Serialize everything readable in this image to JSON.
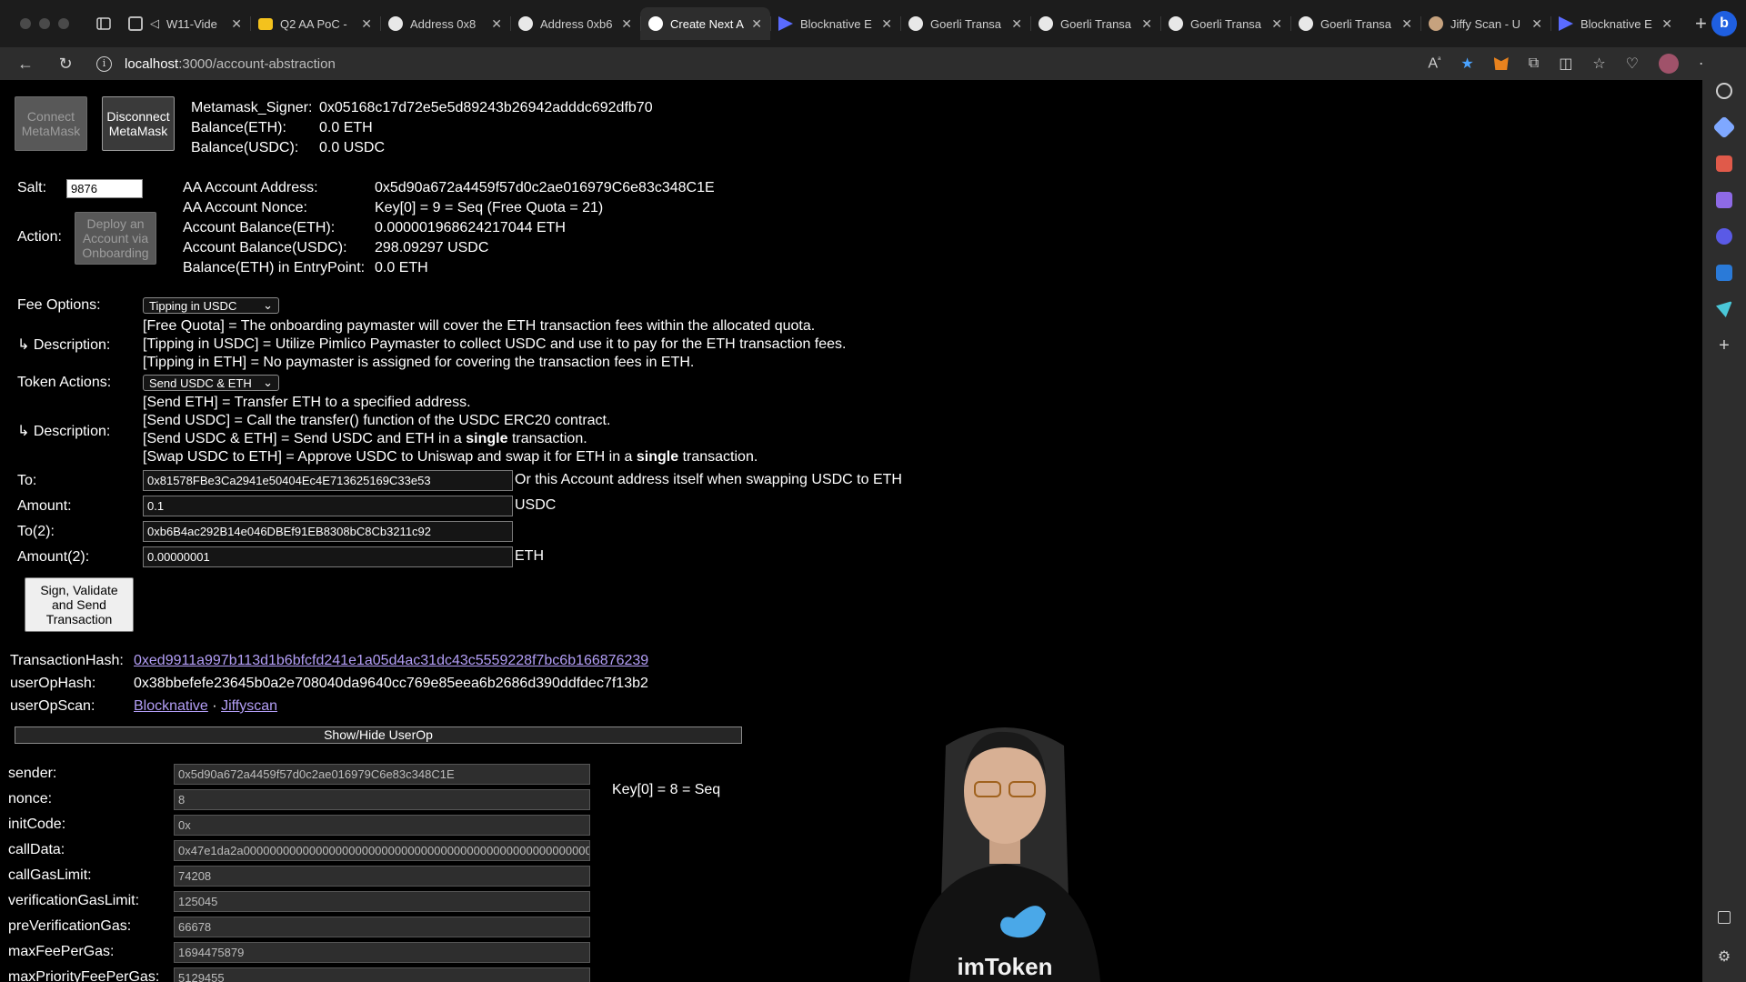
{
  "browser": {
    "tabs": [
      {
        "title": "W11-Vide",
        "icon": "video-tab-icon"
      },
      {
        "title": "Q2 AA PoC - ",
        "icon": "slides-tab-icon"
      },
      {
        "title": "Address 0x8",
        "icon": "etherscan-tab-icon"
      },
      {
        "title": "Address 0xb6",
        "icon": "etherscan-tab-icon"
      },
      {
        "title": "Create Next A",
        "icon": "nextjs-tab-icon",
        "active": true
      },
      {
        "title": "Blocknative E",
        "icon": "blocknative-tab-icon"
      },
      {
        "title": "Goerli Transa",
        "icon": "etherscan-tab-icon"
      },
      {
        "title": "Goerli Transa",
        "icon": "etherscan-tab-icon"
      },
      {
        "title": "Goerli Transa",
        "icon": "etherscan-tab-icon"
      },
      {
        "title": "Goerli Transa",
        "icon": "etherscan-tab-icon"
      },
      {
        "title": "Jiffy Scan - U",
        "icon": "jiffyscan-tab-icon"
      },
      {
        "title": "Blocknative E",
        "icon": "blocknative-tab-icon"
      }
    ],
    "url_host": "localhost",
    "url_path": ":3000/account-abstraction"
  },
  "header": {
    "connect_label": "Connect MetaMask",
    "disconnect_label": "Disconnect MetaMask",
    "signer_label": "Metamask_Signer:",
    "signer_value": "0x05168c17d72e5e5d89243b26942adddc692dfb70",
    "balance_eth_label": "Balance(ETH):",
    "balance_eth_value": "0.0 ETH",
    "balance_usdc_label": "Balance(USDC):",
    "balance_usdc_value": "0.0 USDC"
  },
  "account": {
    "salt_label": "Salt:",
    "salt_value": "9876",
    "action_label": "Action:",
    "deploy_label": "Deploy an Account via Onboarding",
    "address_label": "AA Account Address:",
    "address_value": "0x5d90a672a4459f57d0c2ae016979C6e83c348C1E",
    "nonce_label": "AA Account Nonce:",
    "nonce_value": "Key[0] = 9 = Seq (Free Quota = 21)",
    "acct_eth_label": "Account Balance(ETH):",
    "acct_eth_value": "0.000001968624217044 ETH",
    "acct_usdc_label": "Account Balance(USDC):",
    "acct_usdc_value": "298.09297 USDC",
    "entry_label": "Balance(ETH) in EntryPoint:",
    "entry_value": "0.0 ETH"
  },
  "fees": {
    "label": "Fee Options:",
    "selected": "Tipping in USDC",
    "desc_label": "↳ Description:",
    "lines": [
      "[Free Quota] = The onboarding paymaster will cover the ETH transaction fees within the allocated quota.",
      "[Tipping in USDC] = Utilize Pimlico Paymaster to collect USDC and use it to pay for the ETH transaction fees.",
      "[Tipping in ETH] = No paymaster is assigned for covering the transaction fees in ETH."
    ]
  },
  "tokens": {
    "label": "Token Actions:",
    "selected": "Send USDC & ETH",
    "desc_label": "↳ Description:",
    "line1": "[Send ETH] = Transfer ETH to a specified address.",
    "line2": "[Send USDC] = Call the transfer() function of the USDC ERC20 contract.",
    "line3_a": "[Send USDC & ETH] = Send USDC and ETH in a ",
    "line3_bold": "single",
    "line3_b": " transaction.",
    "line4_a": "[Swap USDC to ETH] = Approve USDC to Uniswap and swap it for ETH in a ",
    "line4_bold": "single",
    "line4_b": " transaction."
  },
  "transfer": {
    "to_label": "To:",
    "to_value": "0x81578FBe3Ca2941e50404Ec4E713625169C33e53",
    "to_note": "Or this Account address itself when swapping USDC to ETH",
    "amount_label": "Amount:",
    "amount_value": "0.1",
    "amount_unit": "USDC",
    "to2_label": "To(2):",
    "to2_value": "0xb6B4ac292B14e046DBEf91EB8308bC8Cb3211c92",
    "amount2_label": "Amount(2):",
    "amount2_value": "0.00000001",
    "amount2_unit": "ETH",
    "send_label": "Sign, Validate and Send Transaction"
  },
  "result": {
    "tx_label": "TransactionHash:",
    "tx_value": "0xed9911a997b113d1b6bfcfd241e1a05d4ac31dc43c5559228f7bc6b166876239",
    "op_label": "userOpHash:",
    "op_value": "0x38bbefefe23645b0a2e708040da9640cc769e85eea6b2686d390ddfdec7f13b2",
    "scan_label": "userOpScan:",
    "scan_link1": "Blocknative",
    "scan_sep": "·",
    "scan_link2": "Jiffyscan",
    "toggle_label": "Show/Hide UserOp"
  },
  "userop": {
    "nonce_note": "Key[0] = 8 = Seq",
    "rows": [
      {
        "label": "sender:",
        "value": "0x5d90a672a4459f57d0c2ae016979C6e83c348C1E"
      },
      {
        "label": "nonce:",
        "value": "8"
      },
      {
        "label": "initCode:",
        "value": "0x"
      },
      {
        "label": "callData:",
        "value": "0x47e1da2a000000000000000000000000000000000000000000000000000000000000"
      },
      {
        "label": "callGasLimit:",
        "value": "74208"
      },
      {
        "label": "verificationGasLimit:",
        "value": "125045"
      },
      {
        "label": "preVerificationGas:",
        "value": "66678"
      },
      {
        "label": "maxFeePerGas:",
        "value": "1694475879"
      },
      {
        "label": "maxPriorityFeePerGas:",
        "value": "5129455"
      }
    ]
  },
  "presenter": {
    "shirt_text": "imToken"
  }
}
